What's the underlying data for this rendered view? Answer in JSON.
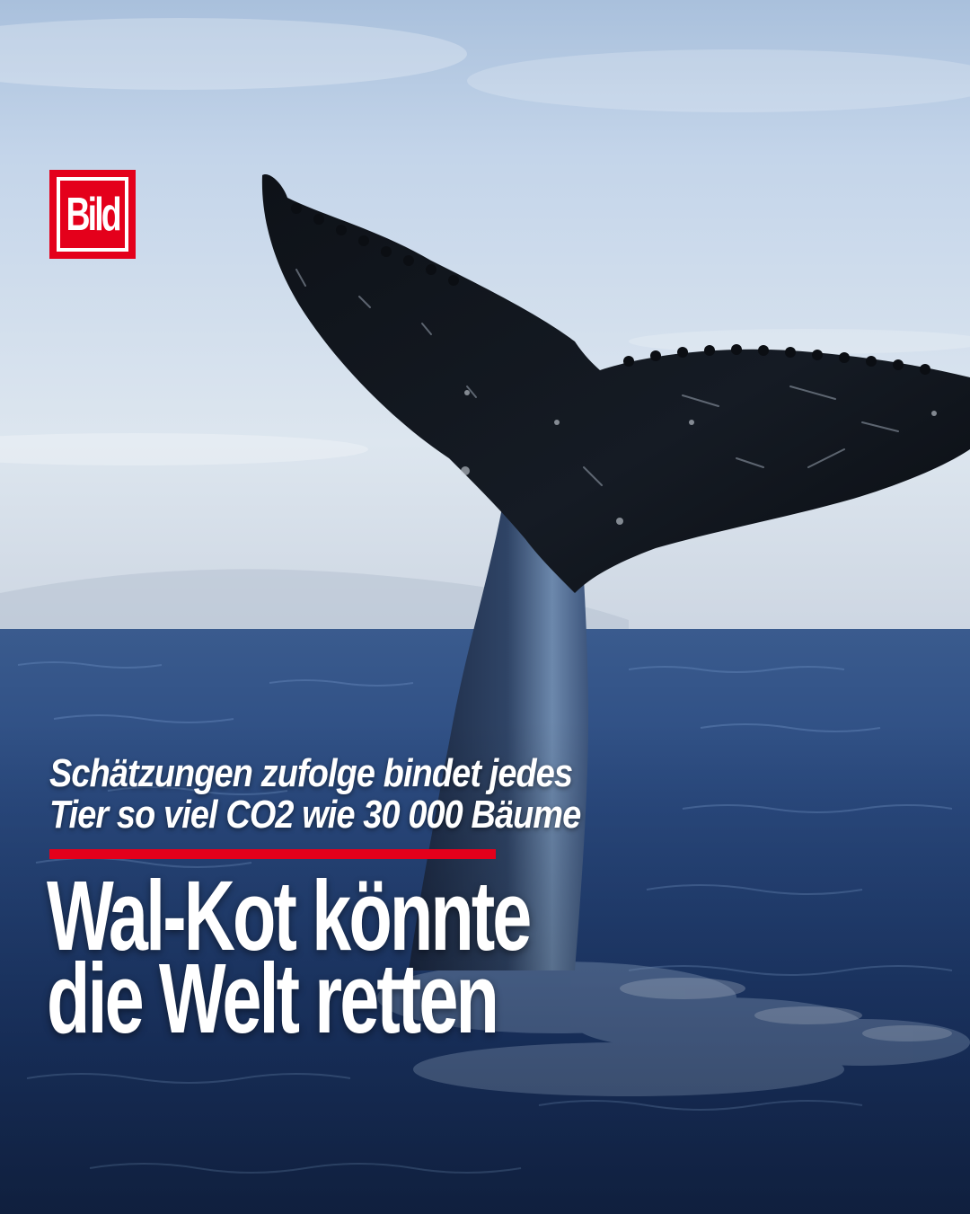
{
  "logo": {
    "text": "Bild",
    "color": "#e4001b"
  },
  "kicker": {
    "line1": "Schätzungen zufolge bindet jedes",
    "line2": "Tier so viel CO2 wie 30 000 Bäume"
  },
  "headline": {
    "line1": "Wal-Kot könnte",
    "line2": "die Welt retten"
  },
  "colors": {
    "accent": "#e4001b",
    "sky": "#c9d8ea",
    "sea": "#1c3566"
  }
}
